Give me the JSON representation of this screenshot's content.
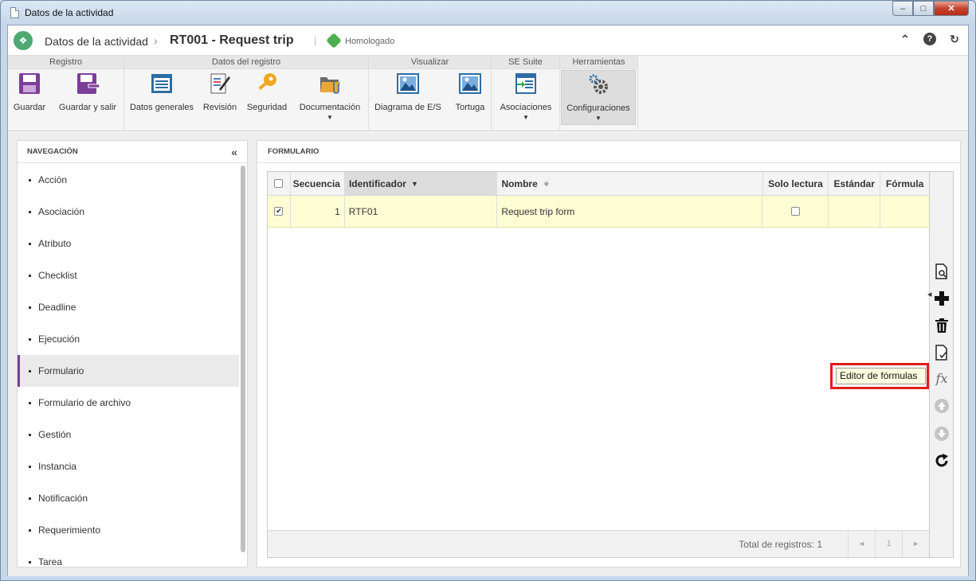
{
  "window": {
    "title": "Datos de la actividad",
    "controls": {
      "minimize": "–",
      "maximize": "□",
      "close": "✕"
    }
  },
  "header": {
    "breadcrumb_parent": "Datos de la actividad",
    "breadcrumb_separator": "›",
    "breadcrumb_current": "RT001 - Request trip",
    "divider": "|",
    "status": "Homologado",
    "status_color": "#4caf50"
  },
  "ribbon": {
    "groups": [
      {
        "title": "Registro"
      },
      {
        "title": "Datos del registro"
      },
      {
        "title": "Visualizar"
      },
      {
        "title": "SE Suite"
      },
      {
        "title": "Herramientas"
      }
    ],
    "buttons": {
      "guardar": "Guardar",
      "guardar_salir": "Guardar y salir",
      "datos_generales": "Datos generales",
      "revision": "Revisión",
      "seguridad": "Seguridad",
      "documentacion": "Documentación",
      "diagrama": "Diagrama de E/S",
      "tortuga": "Tortuga",
      "asociaciones": "Asociaciones",
      "configuraciones": "Configuraciones"
    }
  },
  "nav": {
    "title": "NAVEGACIÓN",
    "collapse_icon": "«",
    "items": [
      {
        "label": "Acción"
      },
      {
        "label": "Asociación"
      },
      {
        "label": "Atributo"
      },
      {
        "label": "Checklist"
      },
      {
        "label": "Deadline"
      },
      {
        "label": "Ejecución"
      },
      {
        "label": "Formulario",
        "active": true
      },
      {
        "label": "Formulario de archivo"
      },
      {
        "label": "Gestión"
      },
      {
        "label": "Instancia"
      },
      {
        "label": "Notificación"
      },
      {
        "label": "Requerimiento"
      },
      {
        "label": "Tarea"
      }
    ],
    "accent_color": "#7b3e98"
  },
  "form": {
    "title": "FORMULARIO",
    "columns": {
      "secuencia": "Secuencia",
      "identificador": "Identificador",
      "nombre": "Nombre",
      "solo_lectura": "Solo lectura",
      "estandar": "Estándar",
      "formula": "Fórmula"
    },
    "rows": [
      {
        "secuencia": "1",
        "identificador": "RTF01",
        "nombre": "Request trip form",
        "checked": true,
        "solo_lectura": false
      }
    ],
    "footer": {
      "total": "Total de registros: 1",
      "page": "1",
      "prev": "◄",
      "next": "►"
    },
    "row_highlight": "#fdfdd3"
  },
  "tooltip": {
    "text": "Editor de fórmulas"
  }
}
